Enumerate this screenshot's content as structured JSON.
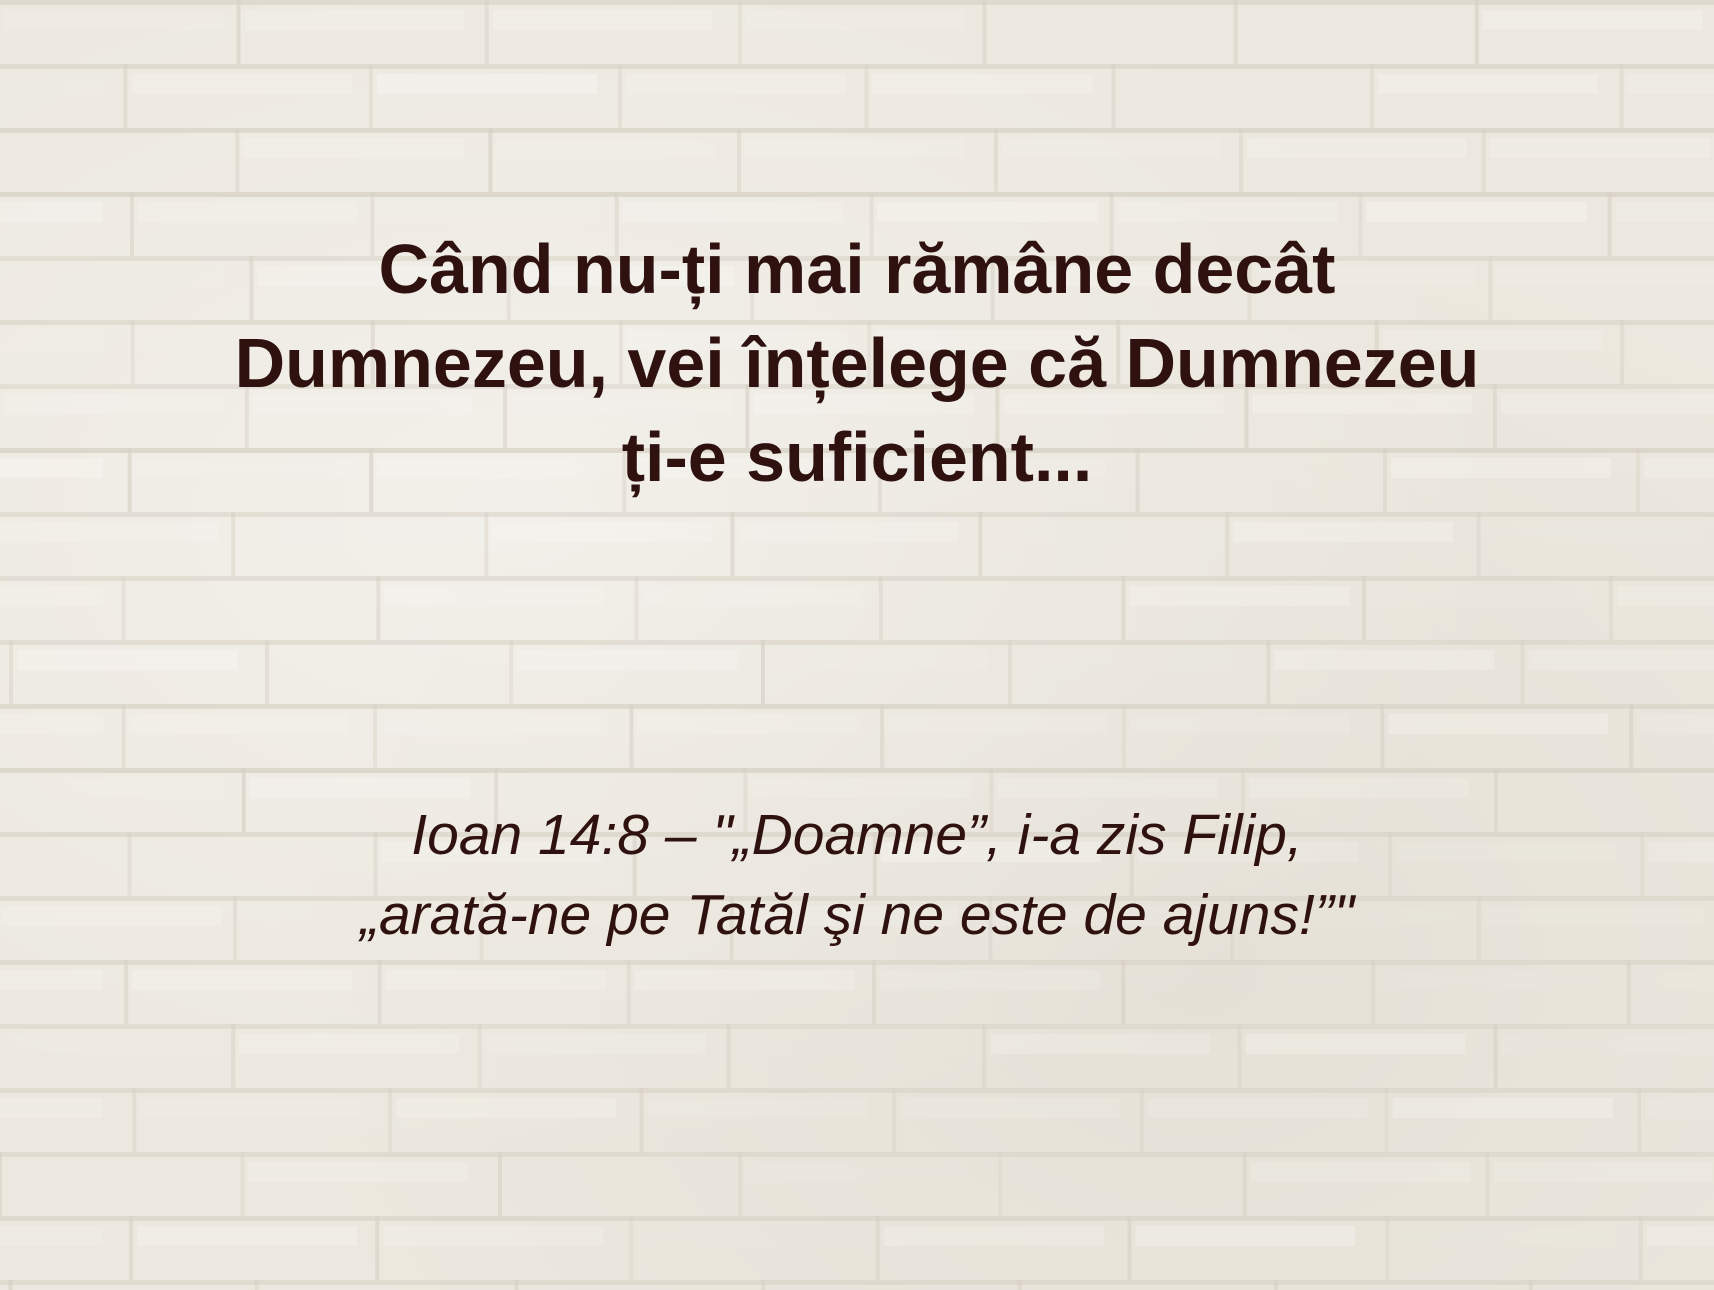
{
  "background": {
    "texture_icon": "white-painted-brick-wall",
    "base_color": "#ece8df",
    "mortar_color": "#d6d0c4"
  },
  "quote": {
    "text": "Când nu-ți mai rămâne decât\nDumnezeu, vei înțelege că Dumnezeu\nți-e suficient...",
    "color": "#2f1210"
  },
  "verse": {
    "text": "Ioan 14:8 – \"„Doamne”, i-a zis Filip,\n„arată-ne pe Tatăl şi ne este de ajuns!”\"",
    "color": "#2f1210"
  }
}
